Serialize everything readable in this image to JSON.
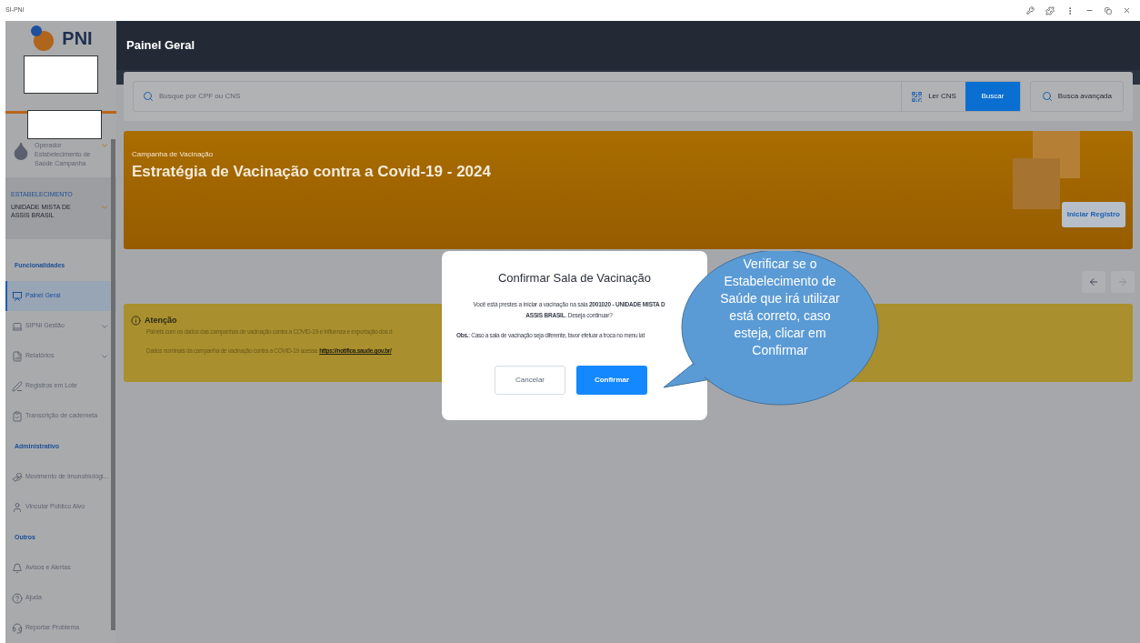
{
  "window": {
    "title": "SI-PNI"
  },
  "sidebar": {
    "logo_text": "PNI",
    "operator": {
      "role": "Operador",
      "unit": "Estabelecimento de Saúde Campanha"
    },
    "establishment": {
      "label": "ESTABELECIMENTO",
      "name": "UNIDADE MISTA DE ASSIS BRASIL"
    },
    "sections": [
      {
        "title": "Funcionalidades",
        "items": [
          {
            "label": "Painel Geral",
            "selected": true,
            "expandable": false
          },
          {
            "label": "SIPNI Gestão",
            "selected": false,
            "expandable": true
          },
          {
            "label": "Relatórios",
            "selected": false,
            "expandable": true
          },
          {
            "label": "Registros em Lote",
            "selected": false,
            "expandable": false
          },
          {
            "label": "Transcrição de caderneta",
            "selected": false,
            "expandable": false
          }
        ]
      },
      {
        "title": "Administrativo",
        "items": [
          {
            "label": "Movimento de Imunobiológi...",
            "selected": false,
            "expandable": false
          },
          {
            "label": "Vincular Público Alvo",
            "selected": false,
            "expandable": false
          }
        ]
      },
      {
        "title": "Outros",
        "items": [
          {
            "label": "Avisos e Alertas",
            "selected": false,
            "expandable": false
          },
          {
            "label": "Ajuda",
            "selected": false,
            "expandable": false
          },
          {
            "label": "Reportar Problema",
            "selected": false,
            "expandable": false
          }
        ]
      }
    ]
  },
  "header": {
    "title": "Painel Geral"
  },
  "search": {
    "placeholder": "Busque por CPF ou CNS",
    "read_button": "Ler CNS",
    "search_button": "Buscar",
    "advanced_button": "Busca avançada"
  },
  "campaign": {
    "label": "Campanha de Vacinação",
    "title": "Estratégia de Vacinação contra a Covid-19 - 2024",
    "button": "Iniciar Registro"
  },
  "alert": {
    "title": "Atenção",
    "text": "Painéis com os dados das campanhas de vacinação contra a COVID-19 e Influenza e exportação dos d",
    "text_2": "Dados nominais da campanha de vacinação contra a COVID-19 acesse",
    "link": "https://notifica.saude.gov.br/"
  },
  "dialog": {
    "title": "Confirmar Sala de Vacinação",
    "message": "Você está prestes a iniciar a vacinação na sala **2001020 - UNIDADE MISTA D**",
    "message_2": "**ASSIS BRASIL**. Deseja continuar?",
    "note": "**Obs.**: Caso a sala de vacinação seja diferente, favor efetuar a troca no menu lat",
    "cancel": "Cancelar",
    "confirm": "Confirmar"
  },
  "callout": {
    "text": "Verificar se o Estabelecimento de Saúde que irá utilizar está correto, caso esteja, clicar em Confirmar"
  }
}
